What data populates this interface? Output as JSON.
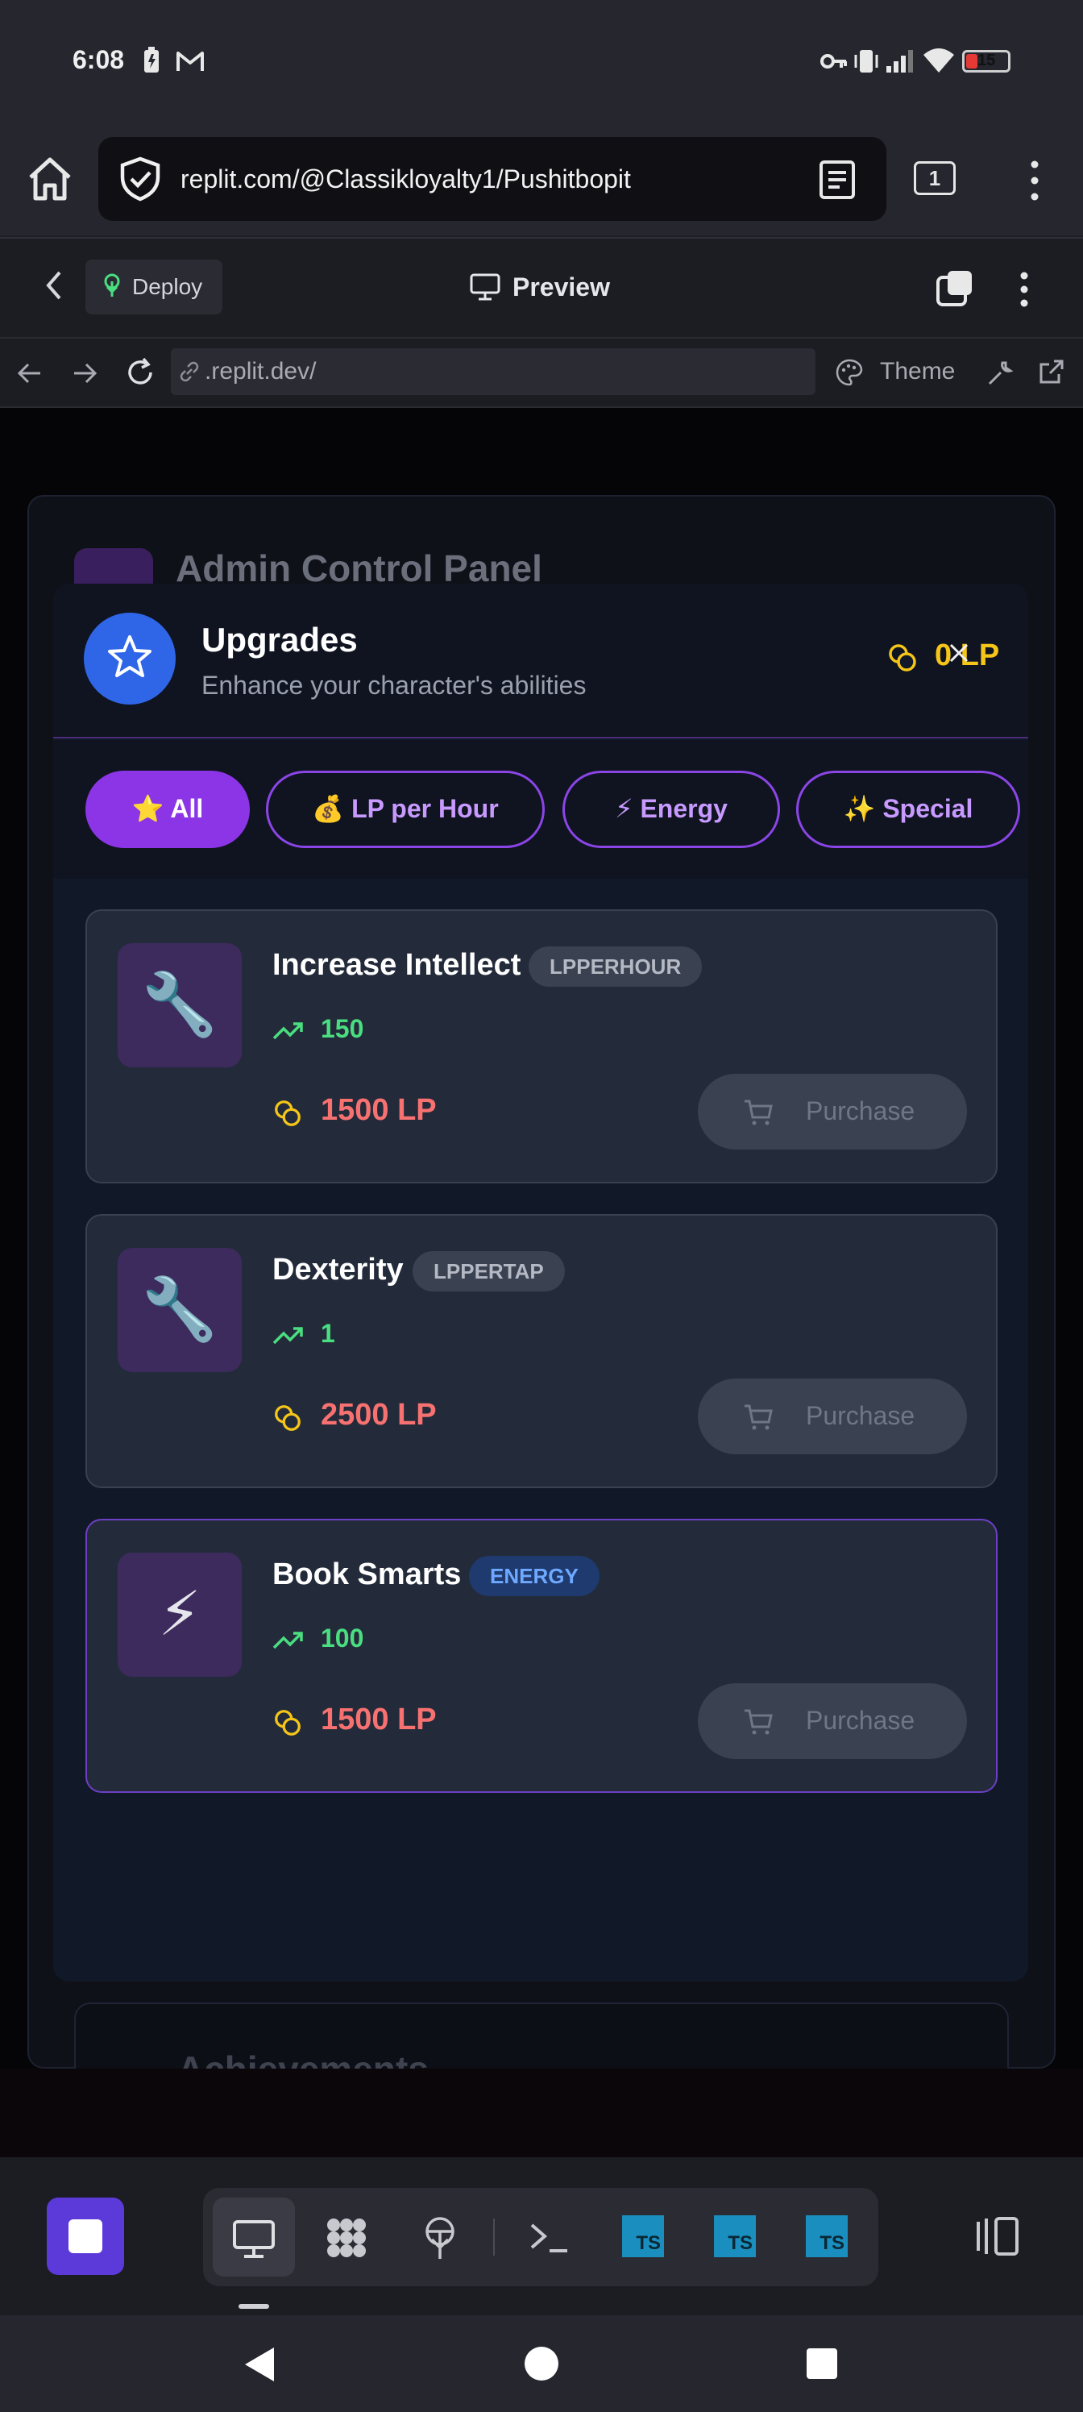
{
  "status_bar": {
    "time": "6:08",
    "battery": "15"
  },
  "browser": {
    "url": "replit.com/@Classikloyalty1/Pushitbopit",
    "tab_count": "1"
  },
  "replit_toolbar": {
    "deploy_label": "Deploy",
    "preview_label": "Preview"
  },
  "webview_nav": {
    "address": ".replit.dev/",
    "theme_label": "Theme"
  },
  "admin_panel": {
    "title": "Admin Control Panel",
    "achievements_title": "Achievements"
  },
  "upgrades_modal": {
    "title": "Upgrades",
    "subtitle": "Enhance your character's abilities",
    "lp_balance": "0 LP",
    "tabs": [
      {
        "label": "⭐ All",
        "active": true
      },
      {
        "label": "💰 LP per Hour",
        "active": false
      },
      {
        "label": "⚡ Energy",
        "active": false
      },
      {
        "label": "✨ Special",
        "active": false
      }
    ],
    "cards": [
      {
        "icon": "wrench-icon",
        "glyph": "🔧",
        "name": "Increase Intellect",
        "badge": "LPPERHOUR",
        "effect": "150",
        "cost": "1500 LP",
        "button": "Purchase"
      },
      {
        "icon": "wrench-icon",
        "glyph": "🔧",
        "name": "Dexterity",
        "badge": "LPPERTAP",
        "effect": "1",
        "cost": "2500 LP",
        "button": "Purchase"
      },
      {
        "icon": "lightning-icon",
        "glyph": "⚡",
        "name": "Book Smarts",
        "badge": "ENERGY",
        "effect": "100",
        "cost": "1500 LP",
        "button": "Purchase"
      }
    ]
  },
  "dock": {
    "ts_label": "TS"
  },
  "colors": {
    "accent_purple": "#8b35e6",
    "star_blue": "#2f66e8",
    "lp_gold": "#f5c518",
    "cost_red": "#f87171",
    "effect_green": "#4ade80",
    "stop_purple": "#5b3ad9"
  }
}
